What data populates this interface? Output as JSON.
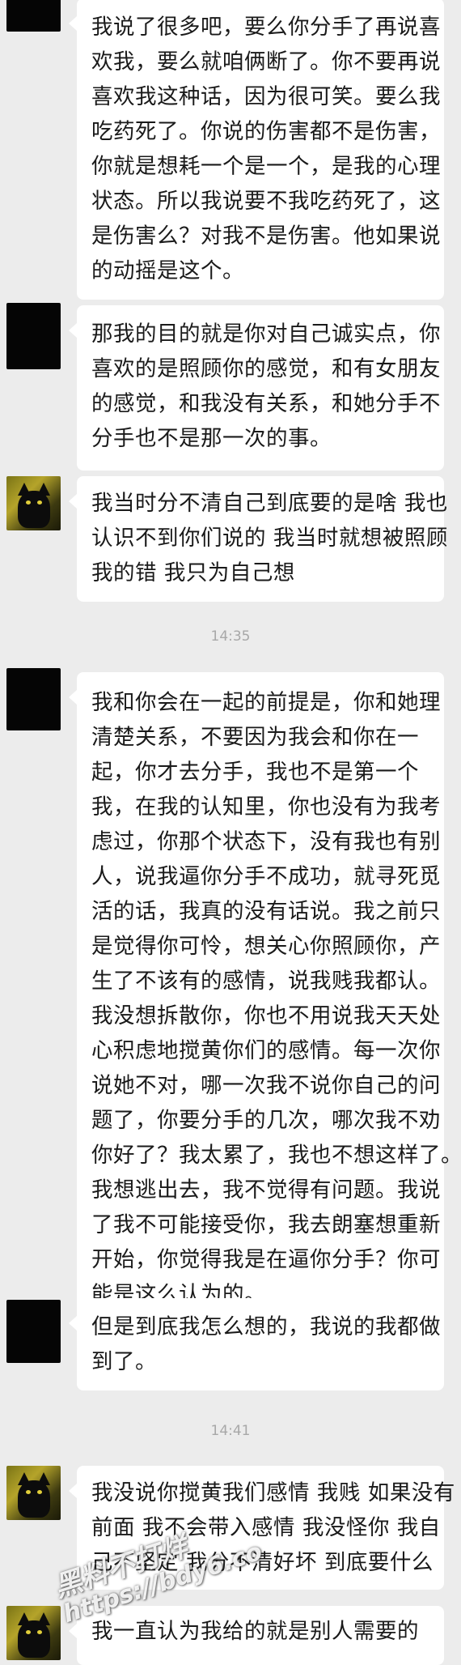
{
  "messages": [
    {
      "sender": "redacted",
      "lines": [
        "我说了很多吧，要么你分手了再说喜",
        "欢我，要么就咱俩断了。你不要再说",
        "喜欢我这种话，因为很可笑。要么我",
        "吃药死了。你说的伤害都不是伤害，",
        "你就是想耗一个是一个，是我的心理",
        "状态。所以我说要不我吃药死了，这",
        "是伤害么？对我不是伤害。他如果说",
        "的动摇是这个。"
      ]
    },
    {
      "sender": "redacted",
      "lines": [
        "那我的目的就是你对自己诚实点，你",
        "喜欢的是照顾你的感觉，和有女朋友",
        "的感觉，和我没有关系，和她分手不",
        "分手也不是那一次的事。"
      ]
    },
    {
      "sender": "cat",
      "lines": [
        "我当时分不清自己到底要的是啥 我也",
        "认识不到你们说的 我当时就想被照顾",
        "我的错 我只为自己想"
      ]
    },
    {
      "sender": "redacted",
      "lines": [
        "我和你会在一起的前提是，你和她理",
        "清楚关系，不要因为我会和你在一",
        "起，你才去分手，我也不是第一个",
        "我，在我的认知里，你也没有为我考",
        "虑过，你那个状态下，没有我也有别",
        "人，说我逼你分手不成功，就寻死觅",
        "活的话，我真的没有话说。我之前只",
        "是觉得你可怜，想关心你照顾你，产",
        "生了不该有的感情，说我贱我都认。",
        "我没想拆散你，你也不用说我天天处",
        "心积虑地搅黄你们的感情。每一次你",
        "说她不对，哪一次我不说你自己的问",
        "题了，你要分手的几次，哪次我不劝",
        "你好了？我太累了，我也不想这样了。",
        "我想逃出去，我不觉得有问题。我说",
        "了我不可能接受你，我去朗塞想重新",
        "开始，你觉得我是在逼你分手？你可",
        "能是这么认为的。"
      ]
    },
    {
      "sender": "redacted",
      "lines": [
        "但是到底我怎么想的，我说的我都做",
        "到了。"
      ]
    },
    {
      "sender": "cat",
      "lines": [
        "我没说你搅黄我们感情 我贱 如果没有",
        "前面 我不会带入感情 我没怪你 我自",
        "己不坚定 我分不清好坏 到底要什么"
      ]
    },
    {
      "sender": "cat",
      "lines": [
        "我一直认为我给的就是别人需要的"
      ]
    }
  ],
  "timestamps": [
    "14:35",
    "14:41"
  ],
  "watermark": {
    "line1": "黑料不打烊",
    "line2": "https://bdy6.co"
  },
  "colors": {
    "background": "#ececec",
    "bubble": "#ffffff",
    "text": "#1a1a1a",
    "timestamp": "#a8a8a8"
  }
}
